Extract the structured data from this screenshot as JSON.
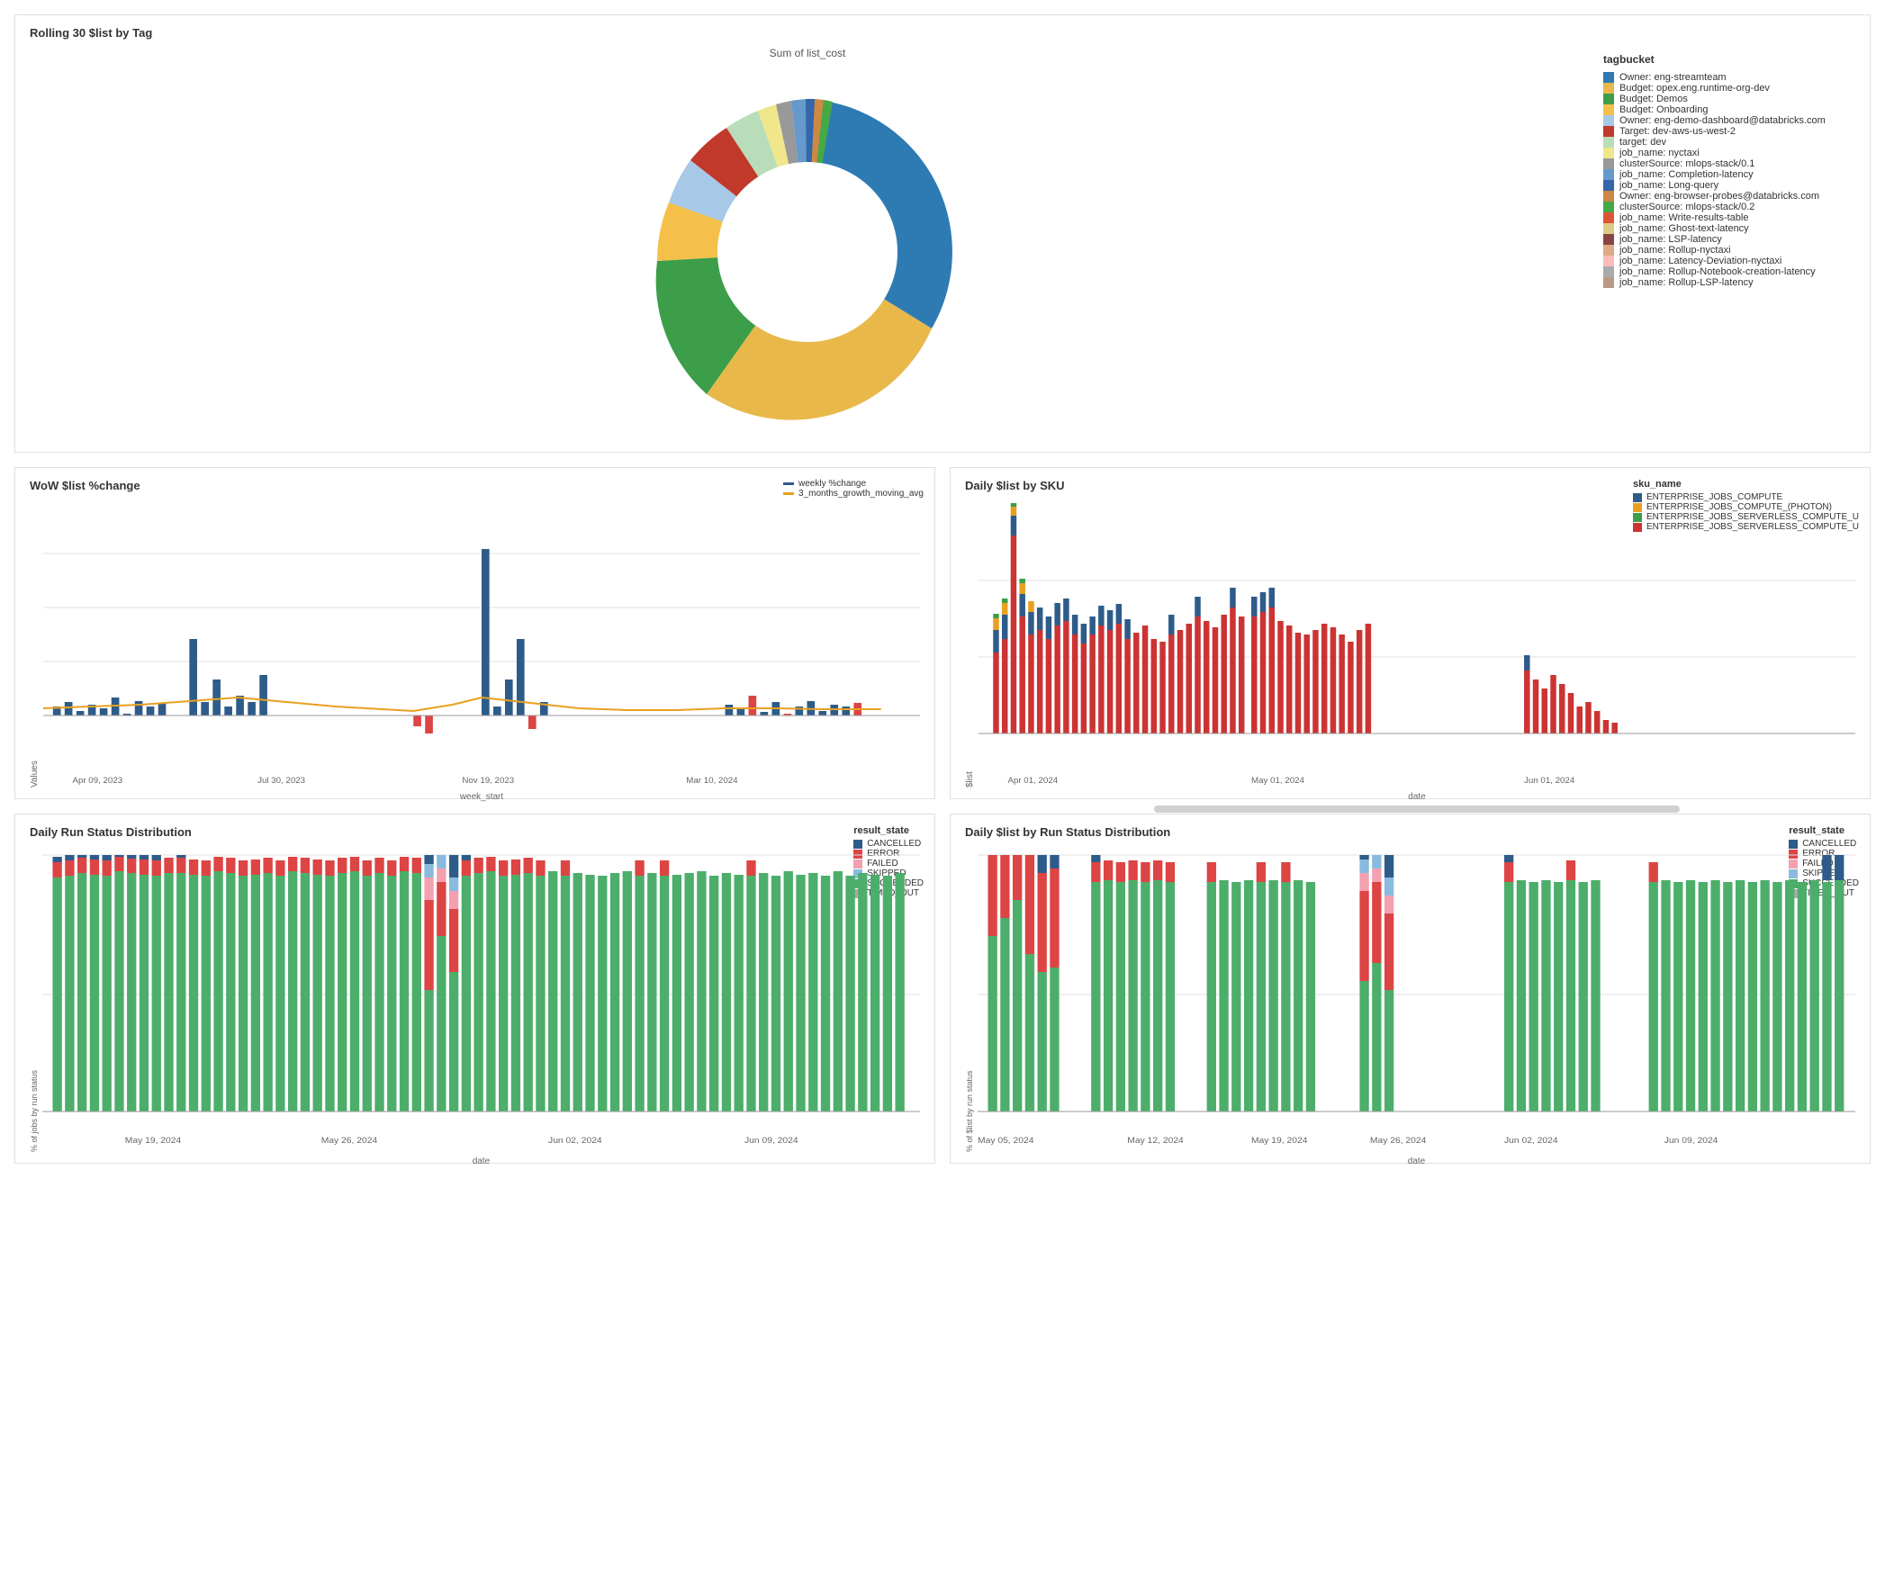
{
  "top": {
    "title": "Rolling 30 $list by Tag",
    "chart_title": "Sum of list_cost",
    "legend_title": "tagbucket",
    "legend_items": [
      {
        "label": "Owner: eng-streamteam",
        "color": "#2e7bb4"
      },
      {
        "label": "Budget: opex.eng.runtime-org-dev",
        "color": "#e8b84b"
      },
      {
        "label": "Budget: Demos",
        "color": "#3d9e4a"
      },
      {
        "label": "Budget: Onboarding",
        "color": "#f5c04a"
      },
      {
        "label": "Owner: eng-demo-dashboard@databricks.com",
        "color": "#a8c8e8"
      },
      {
        "label": "Target: dev-aws-us-west-2",
        "color": "#c0392b"
      },
      {
        "label": "target: dev",
        "color": "#b8ddb8"
      },
      {
        "label": "job_name: nyctaxi",
        "color": "#f0e68c"
      },
      {
        "label": "clusterSource: mlops-stack/0.1",
        "color": "#999"
      },
      {
        "label": "job_name: Completion-latency",
        "color": "#6699cc"
      },
      {
        "label": "job_name: Long-query",
        "color": "#3366aa"
      },
      {
        "label": "Owner: eng-browser-probes@databricks.com",
        "color": "#cc8844"
      },
      {
        "label": "clusterSource: mlops-stack/0.2",
        "color": "#44aa44"
      },
      {
        "label": "job_name: Write-results-table",
        "color": "#dd5533"
      },
      {
        "label": "job_name: Ghost-text-latency",
        "color": "#ddcc88"
      },
      {
        "label": "job_name: LSP-latency",
        "color": "#884444"
      },
      {
        "label": "job_name: Rollup-nyctaxi",
        "color": "#ddaa88"
      },
      {
        "label": "job_name: Latency-Deviation-nyctaxi",
        "color": "#ffbbbb"
      },
      {
        "label": "job_name: Rollup-Notebook-creation-latency",
        "color": "#aaaaaa"
      },
      {
        "label": "job_name: Rollup-LSP-latency",
        "color": "#bb9988"
      }
    ],
    "donut_segments": [
      {
        "color": "#2e7bb4",
        "pct": 38
      },
      {
        "color": "#e8b84b",
        "pct": 32
      },
      {
        "color": "#3d9e4a",
        "pct": 8
      },
      {
        "color": "#f5c04a",
        "pct": 4
      },
      {
        "color": "#a8c8e8",
        "pct": 3
      },
      {
        "color": "#c0392b",
        "pct": 3
      },
      {
        "color": "#b8ddb8",
        "pct": 2
      },
      {
        "color": "#f0e68c",
        "pct": 1
      },
      {
        "color": "#999",
        "pct": 1
      },
      {
        "color": "#6699cc",
        "pct": 1
      },
      {
        "color": "#3366aa",
        "pct": 1
      },
      {
        "color": "#cc8844",
        "pct": 1
      },
      {
        "color": "#44aa44",
        "pct": 1
      },
      {
        "color": "#dd5533",
        "pct": 1
      },
      {
        "color": "#ddcc88",
        "pct": 1
      },
      {
        "color": "#884444",
        "pct": 0.5
      },
      {
        "color": "#ddaa88",
        "pct": 0.5
      },
      {
        "color": "#ffbbbb",
        "pct": 0.5
      },
      {
        "color": "#aaaaaa",
        "pct": 0.5
      },
      {
        "color": "#bb9988",
        "pct": 0.5
      }
    ]
  },
  "wow": {
    "title": "WoW $list %change",
    "y_label": "Values",
    "x_label": "week_start",
    "legend": [
      {
        "label": "weekly %change",
        "color": "#2e5c8a"
      },
      {
        "label": "3_months_growth_moving_avg",
        "color": "#e8a020"
      }
    ],
    "x_ticks": [
      "Apr 09, 2023",
      "Jul 30, 2023",
      "Nov 19, 2023",
      "Mar 10, 2024"
    ],
    "y_ticks": [
      "-500",
      "0",
      "500",
      "1000"
    ]
  },
  "daily_sku": {
    "title": "Daily $list by SKU",
    "y_label": "$list",
    "x_label": "date",
    "legend_title": "sku_name",
    "legend": [
      {
        "label": "ENTERPRISE_JOBS_COMPUTE",
        "color": "#2e5c8a"
      },
      {
        "label": "ENTERPRISE_JOBS_COMPUTE_(PHOTON)",
        "color": "#e8a020"
      },
      {
        "label": "ENTERPRISE_JOBS_SERVERLESS_COMPUTE_U",
        "color": "#3a9e4a"
      },
      {
        "label": "ENTERPRISE_JOBS_SERVERLESS_COMPUTE_U",
        "color": "#cc3333"
      }
    ],
    "x_ticks": [
      "Apr 01, 2024",
      "May 01, 2024",
      "Jun 01, 2024"
    ],
    "y_ticks": [
      "0",
      "1000",
      "2000"
    ]
  },
  "daily_run_status": {
    "title": "Daily Run Status Distribution",
    "y_label": "% of jobs by run status",
    "x_label": "date",
    "legend_title": "result_state",
    "legend": [
      {
        "label": "CANCELLED",
        "color": "#2e5c8a"
      },
      {
        "label": "ERROR",
        "color": "#dd4444"
      },
      {
        "label": "FAILED",
        "color": "#f4a0b0"
      },
      {
        "label": "SKIPPED",
        "color": "#88bbdd"
      },
      {
        "label": "SUCCEEDED",
        "color": "#4cae6a"
      },
      {
        "label": "TIMED_OUT",
        "color": "#aaaaaa"
      }
    ],
    "x_ticks": [
      "May 19, 2024",
      "May 26, 2024",
      "Jun 02, 2024",
      "Jun 09, 2024"
    ],
    "y_ticks": [
      "0%",
      "50%",
      "100%"
    ]
  },
  "daily_list_run": {
    "title": "Daily $list by Run Status Distribution",
    "y_label": "% of $list by run status",
    "x_label": "date",
    "legend_title": "result_state",
    "legend": [
      {
        "label": "CANCELLED",
        "color": "#2e5c8a"
      },
      {
        "label": "ERROR",
        "color": "#dd4444"
      },
      {
        "label": "FAILED",
        "color": "#f4a0b0"
      },
      {
        "label": "SKIPPED",
        "color": "#88bbdd"
      },
      {
        "label": "SUCCEEDED",
        "color": "#4cae6a"
      },
      {
        "label": "TIMED_OUT",
        "color": "#aaaaaa"
      }
    ],
    "x_ticks": [
      "May 05, 2024",
      "May 12, 2024",
      "May 19, 2024",
      "May 26, 2024",
      "Jun 02, 2024",
      "Jun 09, 2024"
    ],
    "y_ticks": [
      "0%",
      "50%",
      "100%"
    ]
  }
}
